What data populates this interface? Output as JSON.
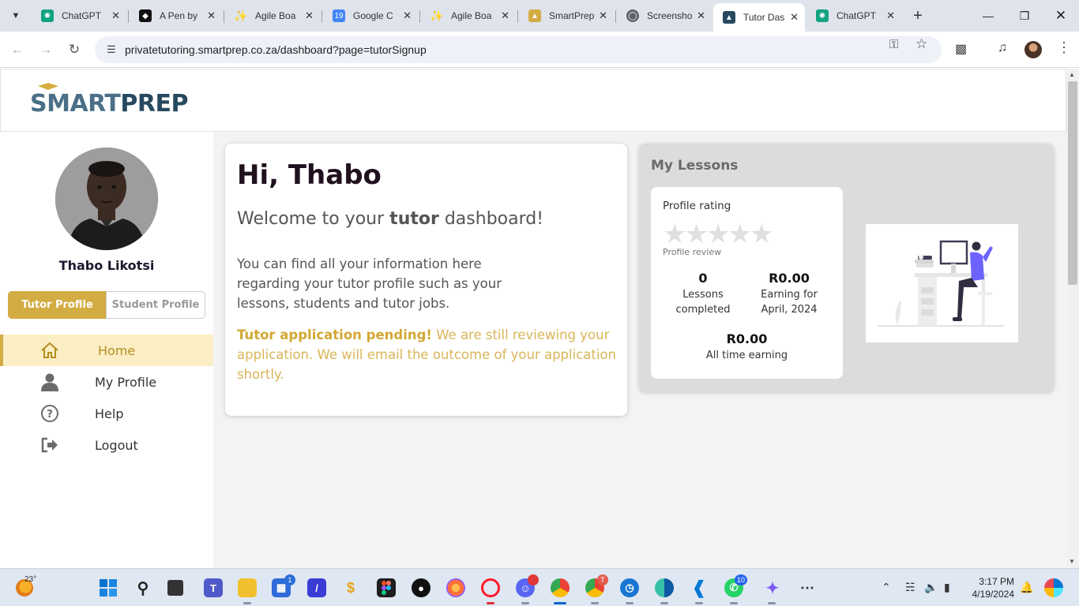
{
  "browser": {
    "tabs": [
      {
        "title": "ChatGPT",
        "icon": "chatgpt-icon",
        "color": "#10a37f"
      },
      {
        "title": "A Pen by",
        "icon": "codepen-icon",
        "color": "#111111"
      },
      {
        "title": "Agile Boa",
        "icon": "sparkle-icon",
        "color": "#f4b400"
      },
      {
        "title": "Google C",
        "icon": "google-calendar-icon",
        "color": "#4285f4",
        "glyph": "19"
      },
      {
        "title": "Agile Boa",
        "icon": "sparkle-icon",
        "color": "#f4b400"
      },
      {
        "title": "SmartPrep",
        "icon": "smartprep-icon",
        "color": "#d4ac44"
      },
      {
        "title": "Screensho",
        "icon": "globe-icon",
        "color": "#5f6368"
      },
      {
        "title": "Tutor Das",
        "icon": "smartprep-icon",
        "color": "#27495f"
      },
      {
        "title": "ChatGPT",
        "icon": "chatgpt-icon",
        "color": "#10a37f"
      }
    ],
    "active_tab_index": 7,
    "url": "privatetutoring.smartprep.co.za/dashboard?page=tutorSignup"
  },
  "site": {
    "logo_smart": "SMART",
    "logo_prep": "PREP"
  },
  "sidebar": {
    "user_name": "Thabo Likotsi",
    "tutor_profile_label": "Tutor Profile",
    "student_profile_label": "Student Profile",
    "nav": [
      {
        "label": "Home",
        "icon": "home-icon",
        "active": true
      },
      {
        "label": "My Profile",
        "icon": "user-icon",
        "active": false
      },
      {
        "label": "Help",
        "icon": "help-icon",
        "active": false
      },
      {
        "label": "Logout",
        "icon": "logout-icon",
        "active": false
      }
    ]
  },
  "welcome": {
    "greeting": "Hi, Thabo",
    "line_pre": "Welcome to your ",
    "line_bold": "tutor",
    "line_post": " dashboard!",
    "intro": "You can find all your information here regarding your tutor profile such as your lessons, students and tutor jobs.",
    "pending_bold": "Tutor application pending!",
    "pending_text": " We are still reviewing your application. We will email the outcome of your application shortly."
  },
  "lessons": {
    "title": "My Lessons",
    "profile_rating_label": "Profile rating",
    "stars_filled": 0,
    "stars_total": 5,
    "profile_review_label": "Profile review",
    "lessons_completed_value": "0",
    "lessons_completed_label": "Lessons completed",
    "earning_value": "R0.00",
    "earning_label": "Earning for April, 2024",
    "all_time_value": "R0.00",
    "all_time_label": "All time earning"
  },
  "taskbar": {
    "weather_temp": "23°",
    "time": "3:17 PM",
    "date": "4/19/2024",
    "badges": {
      "store": "1",
      "chrome_profile": "T",
      "whatsapp": "10"
    }
  },
  "colors": {
    "brand_gold": "#d4ac44",
    "brand_navy": "#27495f",
    "active_nav_bg": "#fbeec4",
    "pending_text": "#d9b558"
  }
}
